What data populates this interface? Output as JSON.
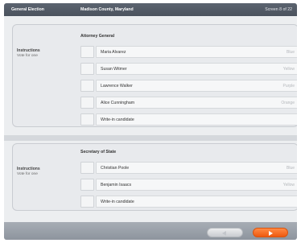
{
  "header": {
    "election": "General Election",
    "county": "Madison County, Maryland",
    "screen": "Screen 8 of 22"
  },
  "contests": [
    {
      "office": "Attorney General",
      "instructions_title": "Instructions",
      "instructions_text": "Vote for one",
      "candidates": [
        {
          "name": "Maria Alvarez",
          "party": "Blue"
        },
        {
          "name": "Susan Witmer",
          "party": "Yellow"
        },
        {
          "name": "Lawrence Walker",
          "party": "Purple"
        },
        {
          "name": "Alice Cunningham",
          "party": "Orange"
        },
        {
          "name": "Write-in candidate",
          "party": ""
        }
      ]
    },
    {
      "office": "Secretary of State",
      "instructions_title": "Instructions",
      "instructions_text": "Vote for one",
      "candidates": [
        {
          "name": "Christian Poole",
          "party": "Blue"
        },
        {
          "name": "Benjamin Isaacs",
          "party": "Yellow"
        },
        {
          "name": "Write-in candidate",
          "party": ""
        }
      ]
    }
  ],
  "footer": {
    "back_icon": "left-triangle-icon",
    "next_icon": "right-triangle-icon",
    "next_color": "#f26a1f"
  }
}
